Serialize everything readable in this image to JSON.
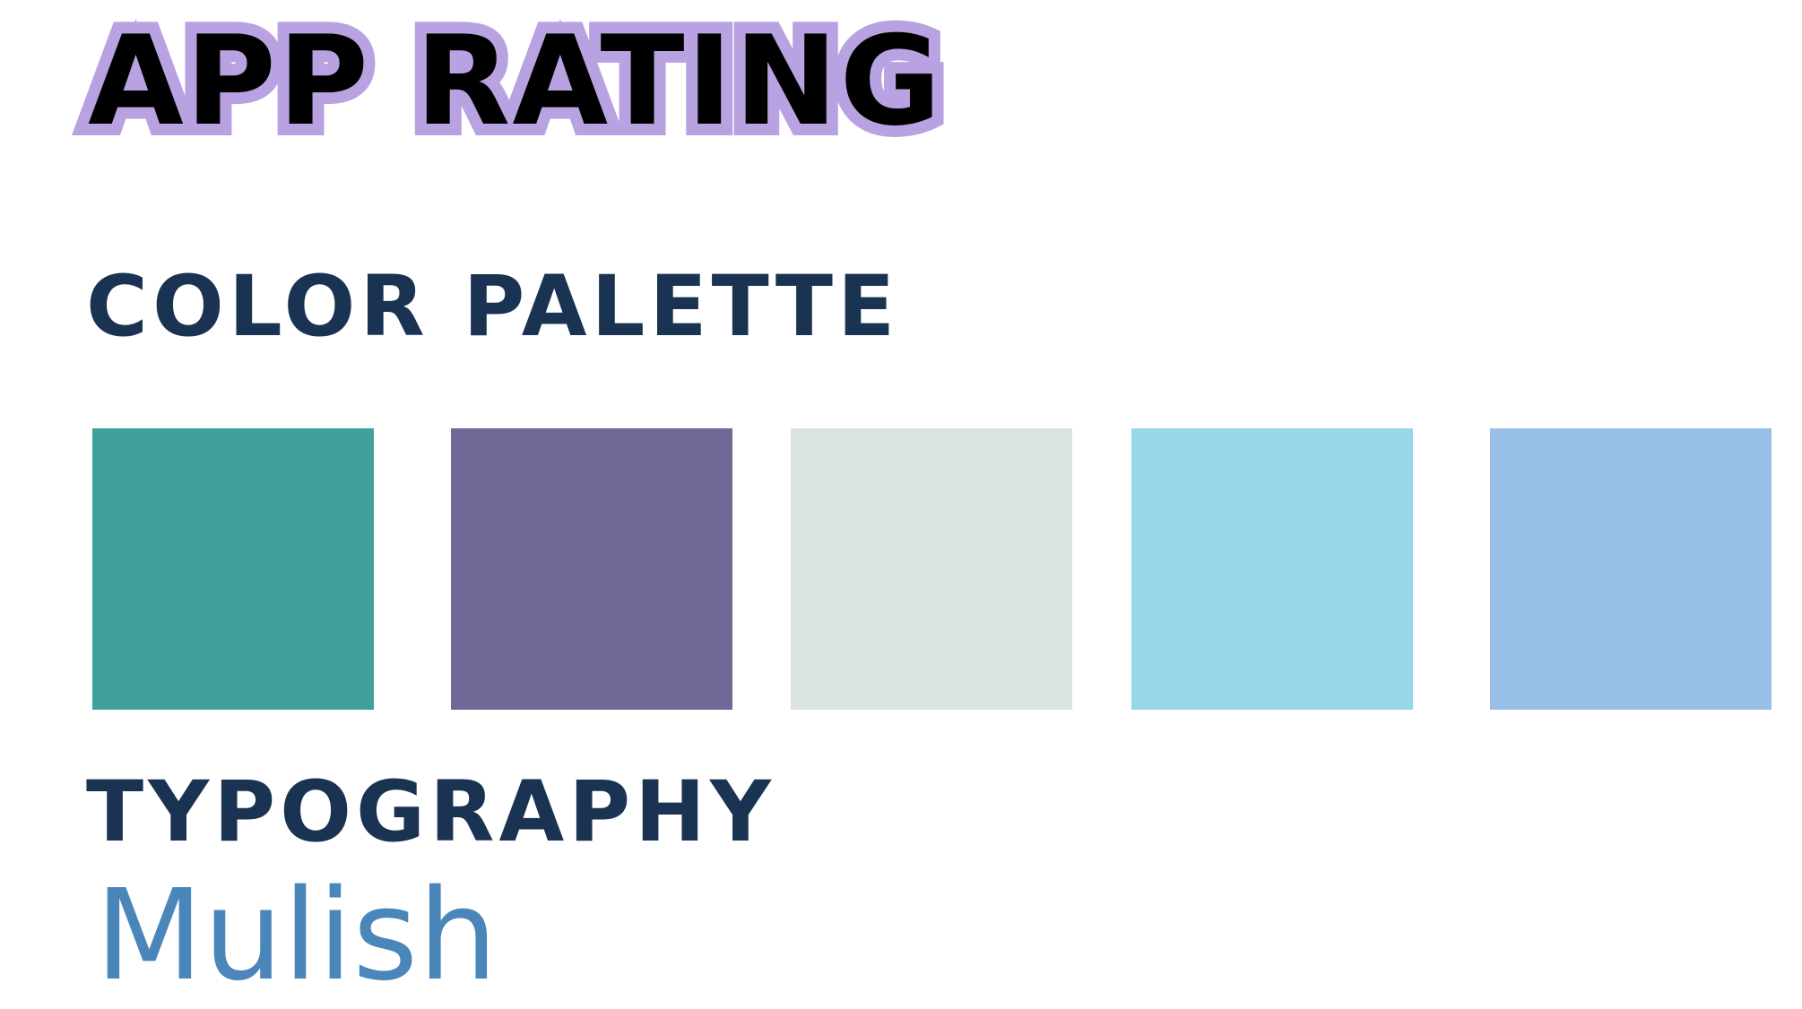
{
  "title": "APP RATING",
  "colors": {
    "title_outline": "#b8a2e2",
    "title_fill": "#000000",
    "heading": "#1a3352",
    "font_sample": "#4a86ba"
  },
  "palette": {
    "heading": "COLOR PALETTE",
    "swatches": [
      {
        "color": "#40a09b"
      },
      {
        "color": "#716898"
      },
      {
        "color": "#d9e4df"
      },
      {
        "color": "#98d6e9"
      },
      {
        "color": "#97bfe8"
      }
    ]
  },
  "typography": {
    "heading": "TYPOGRAPHY",
    "font_name": "Mulish"
  }
}
